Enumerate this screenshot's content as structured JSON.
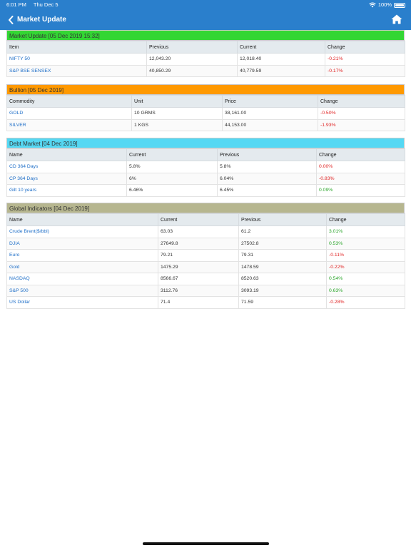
{
  "status": {
    "time": "6:01 PM",
    "date": "Thu Dec 5",
    "battery": "100%"
  },
  "nav": {
    "title": "Market Update"
  },
  "colors": {
    "header_bg": "#2a7fcc",
    "market_header": "#33d633",
    "bullion_header": "#ff9900",
    "debt_header": "#55d8f3",
    "global_header": "#b6b68f",
    "negative": "#e02424",
    "positive": "#2aa52a",
    "link": "#1f6fc8"
  },
  "sections": {
    "market": {
      "title": "Market Update [05 Dec 2019 15:32]",
      "columns": [
        "Item",
        "Previous",
        "Current",
        "Change"
      ],
      "rows": [
        {
          "name": "NIFTY 50",
          "c1": "12,043.20",
          "c2": "12,018.40",
          "change": "-0.21%"
        },
        {
          "name": "S&P BSE SENSEX",
          "c1": "40,850.29",
          "c2": "40,779.59",
          "change": "-0.17%"
        }
      ]
    },
    "bullion": {
      "title": "Bullion [05 Dec 2019]",
      "columns": [
        "Commodity",
        "Unit",
        "Price",
        "Change"
      ],
      "rows": [
        {
          "name": "GOLD",
          "c1": "10 GRMS",
          "c2": "38,161.00",
          "change": "-0.50%"
        },
        {
          "name": "SILVER",
          "c1": "1 KGS",
          "c2": "44,153.00",
          "change": "-1.93%"
        }
      ]
    },
    "debt": {
      "title": "Debt Market [04 Dec 2019]",
      "columns": [
        "Name",
        "Current",
        "Previous",
        "Change"
      ],
      "rows": [
        {
          "name": "CD 364 Days",
          "c1": "5.8%",
          "c2": "5.8%",
          "change": "0.00%"
        },
        {
          "name": "CP 364 Days",
          "c1": "6%",
          "c2": "6.04%",
          "change": "-0.83%"
        },
        {
          "name": "Gilt 10 years",
          "c1": "6.46%",
          "c2": "6.45%",
          "change": "0.09%"
        }
      ]
    },
    "global": {
      "title": "Global Indicators [04 Dec 2019]",
      "columns": [
        "Name",
        "Current",
        "Previous",
        "Change"
      ],
      "rows": [
        {
          "name": "Crude Brent($/bbl)",
          "c1": "63.03",
          "c2": "61.2",
          "change": "3.01%"
        },
        {
          "name": "DJIA",
          "c1": "27649.8",
          "c2": "27502.8",
          "change": "0.53%"
        },
        {
          "name": "Euro",
          "c1": "79.21",
          "c2": "79.31",
          "change": "-0.11%"
        },
        {
          "name": "Gold",
          "c1": "1475.29",
          "c2": "1478.59",
          "change": "-0.22%"
        },
        {
          "name": "NASDAQ",
          "c1": "8566.67",
          "c2": "8520.63",
          "change": "0.54%"
        },
        {
          "name": "S&P 500",
          "c1": "3112.76",
          "c2": "3093.19",
          "change": "0.63%"
        },
        {
          "name": "US Dollar",
          "c1": "71.4",
          "c2": "71.59",
          "change": "-0.28%"
        }
      ]
    }
  }
}
